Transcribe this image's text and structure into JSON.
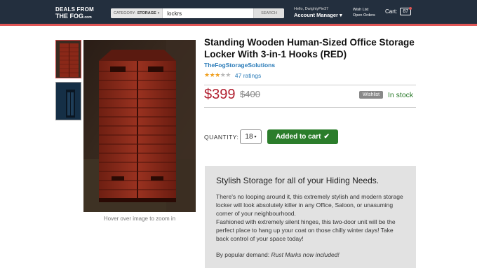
{
  "header": {
    "logo_line1": "DEALS FROM",
    "logo_line2": "THE FOG",
    "logo_suffix": ".com",
    "search": {
      "category_label": "CATEGORY:",
      "category_value": "STORAGE",
      "query": "lockrs",
      "button_label": "SEARCH"
    },
    "account": {
      "greeting": "Hello, DwightyPie37",
      "manager_label": "Account Manager"
    },
    "wishlist_link": "Wish List",
    "orders_link": "Open Orders",
    "cart_label": "Cart:",
    "cart_count": "87"
  },
  "gallery": {
    "zoom_hint": "Hover over image to zoom in"
  },
  "product": {
    "title": "Standing Wooden Human-Sized Office Storage Locker With 3-in-1 Hooks (RED)",
    "seller": "TheFogStorageSolutions",
    "rating_stars": 3,
    "rating_max": 5,
    "ratings_count": "47 ratings",
    "price": "$399",
    "old_price": "$400",
    "wishlist_button": "Wishlist",
    "stock_status": "In stock",
    "quantity_label": "QUANTITY:",
    "quantity_value": "18",
    "add_to_cart": "Added to cart"
  },
  "description": {
    "heading": "Stylish Storage for all of your Hiding Needs.",
    "paragraph1": "There's no looping around it, this extremely stylish and modern storage locker will look absolutely killer in any Office, Saloon, or unasuming corner of your neighbourhood.",
    "paragraph2": "Fashioned with extremely silent hinges, this two-door unit will be the perfect place to hang up your coat on those chilly winter days! Take back control of your space today!",
    "popular_prefix": "By popular demand: ",
    "popular_emphasis": "Rust Marks now included!"
  },
  "colors": {
    "header_bg": "#232f3e",
    "accent_red": "#b12030",
    "stock_green": "#2a7a2a",
    "link_blue": "#2a7bb8",
    "button_green": "#2b7d2b"
  }
}
